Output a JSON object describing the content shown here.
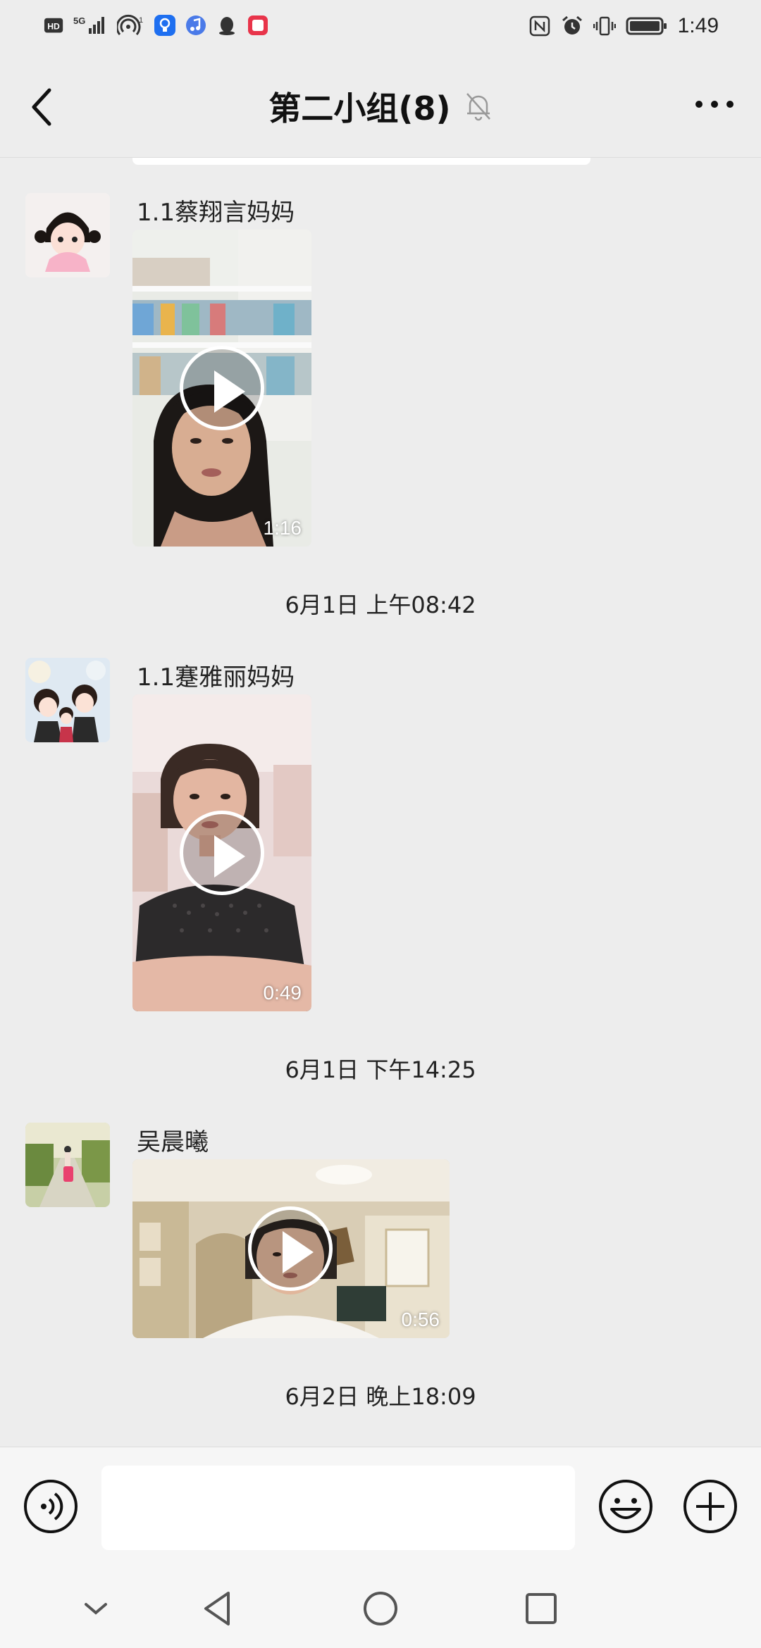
{
  "status_bar": {
    "network_badge": "HD",
    "network_type": "5G",
    "hotspot_count": "1",
    "time": "1:49",
    "icons": [
      "hd-icon",
      "signal-5g-icon",
      "hotspot-icon",
      "lightbulb-app-icon",
      "music-app-icon",
      "qq-icon",
      "red-app-icon",
      "nfc-icon",
      "alarm-icon",
      "vibrate-icon",
      "battery-icon"
    ]
  },
  "header": {
    "title": "第二小组(8)",
    "back_icon": "chevron-left-icon",
    "mute_icon": "bell-muted-icon",
    "more_icon": "more-dots-icon"
  },
  "messages": [
    {
      "sender": "1.1蔡翔言妈妈",
      "duration": "1:16",
      "timestamp": "6月1日 上午08:42"
    },
    {
      "sender": "1.1蹇雅丽妈妈",
      "duration": "0:49",
      "timestamp": "6月1日 下午14:25"
    },
    {
      "sender": "吴晨曦",
      "duration": "0:56",
      "timestamp": "6月2日 晚上18:09"
    }
  ],
  "input_bar": {
    "placeholder": "",
    "voice_icon": "voice-input-icon",
    "emoji_icon": "emoji-icon",
    "plus_icon": "plus-circle-icon"
  },
  "nav_bar": {
    "icons": [
      "collapse-icon",
      "back-triangle-icon",
      "home-circle-icon",
      "recents-square-icon"
    ]
  }
}
